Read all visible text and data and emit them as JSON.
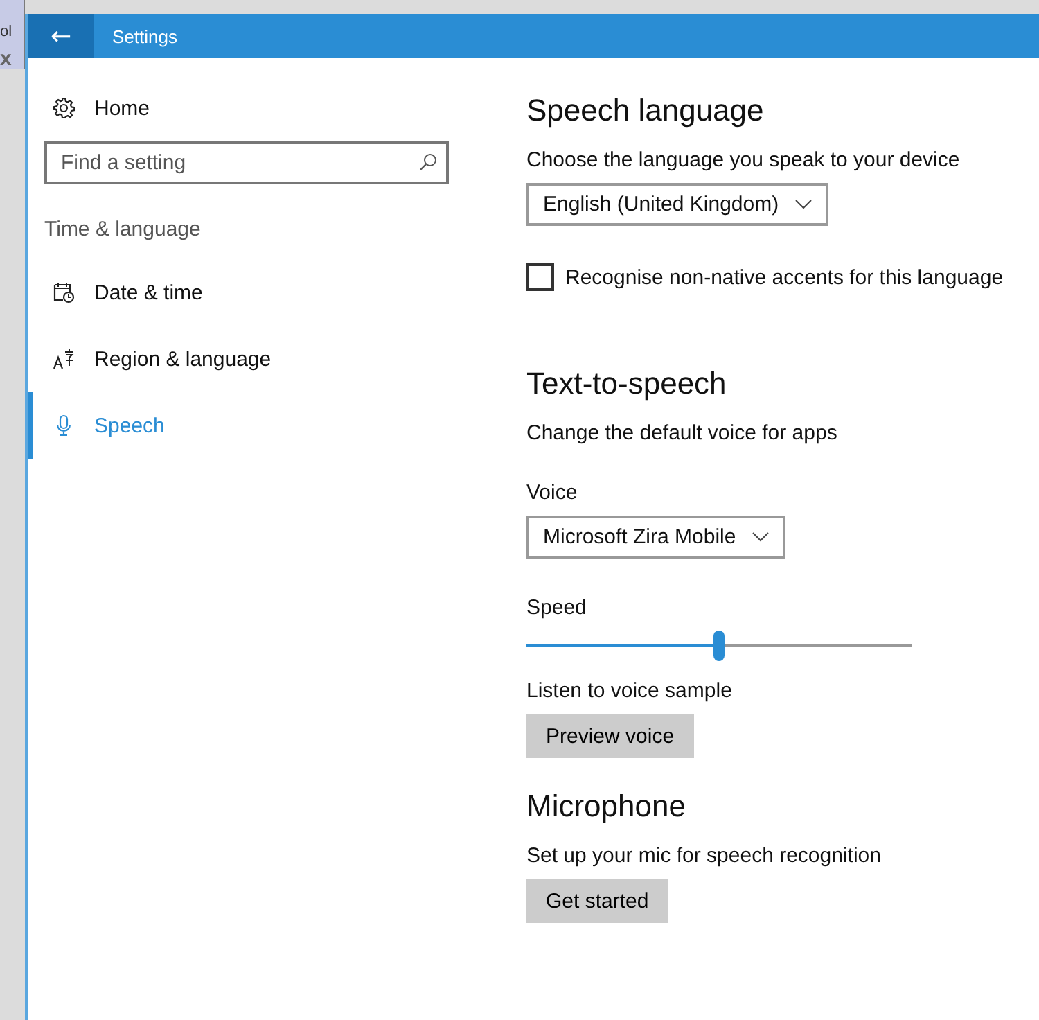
{
  "behind_window": {
    "tab_text": "ol",
    "close_glyph": "x"
  },
  "window": {
    "back_glyph": "←",
    "title": "Settings"
  },
  "sidebar": {
    "home": "Home",
    "search": {
      "placeholder": "Find a setting"
    },
    "group_label": "Time & language",
    "items": [
      {
        "label": "Date & time",
        "kind": "clock",
        "selected": false
      },
      {
        "label": "Region & language",
        "kind": "region",
        "selected": false
      },
      {
        "label": "Speech",
        "kind": "mic",
        "selected": true
      }
    ]
  },
  "sections": [
    {
      "heading": "Speech language",
      "controls": [
        {
          "kind": "dropdown",
          "label": "Choose the language you speak to your device",
          "value": "English (United Kingdom)"
        },
        {
          "kind": "checkbox",
          "label": "Recognise non-native accents for this language",
          "checked": false
        }
      ]
    },
    {
      "heading": "Text-to-speech",
      "controls": [
        {
          "kind": "text",
          "label": "Change the default voice for apps"
        },
        {
          "kind": "dropdown",
          "label": "Voice",
          "value": "Microsoft Zira Mobile"
        },
        {
          "kind": "slider",
          "label": "Speed",
          "level": 0.5
        },
        {
          "kind": "button",
          "label": "Listen to voice sample",
          "value": "Preview voice"
        }
      ]
    },
    {
      "heading": "Microphone",
      "controls": [
        {
          "kind": "button",
          "label": "Set up your mic for speech recognition",
          "value": "Get started"
        }
      ]
    }
  ]
}
